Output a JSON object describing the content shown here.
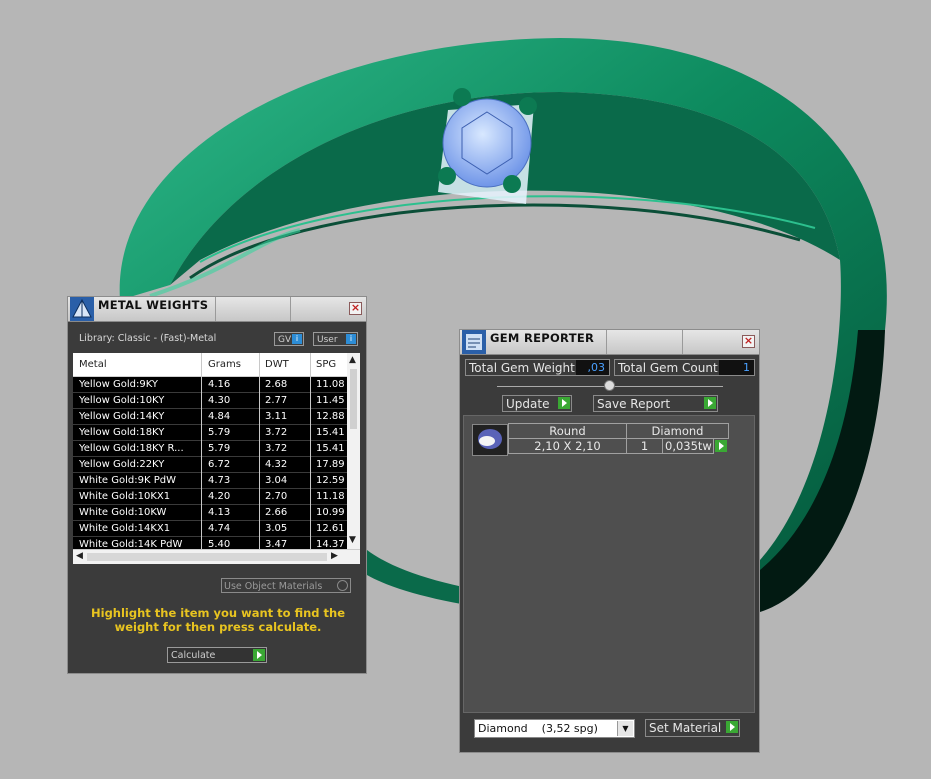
{
  "colors": {
    "background": "#b6b6b6",
    "ring": "#0f8a5f",
    "panel": "#3b3b3b",
    "hint": "#e8c420",
    "gem_value": "#4aa0ff",
    "play": "#3aa834"
  },
  "metal_weights": {
    "title": "METAL WEIGHTS",
    "library_label": "Library: Classic - (Fast)-Metal",
    "btn_gv": "GV",
    "btn_user": "User",
    "table": {
      "headers": [
        "Metal",
        "Grams",
        "DWT",
        "SPG"
      ],
      "rows": [
        [
          "Yellow Gold:9KY",
          "4.16",
          "2.68",
          "11.08"
        ],
        [
          "Yellow Gold:10KY",
          "4.30",
          "2.77",
          "11.45"
        ],
        [
          "Yellow Gold:14KY",
          "4.84",
          "3.11",
          "12.88"
        ],
        [
          "Yellow Gold:18KY",
          "5.79",
          "3.72",
          "15.41"
        ],
        [
          "Yellow Gold:18KY R...",
          "5.79",
          "3.72",
          "15.41"
        ],
        [
          "Yellow Gold:22KY",
          "6.72",
          "4.32",
          "17.89"
        ],
        [
          "White Gold:9K PdW",
          "4.73",
          "3.04",
          "12.59"
        ],
        [
          "White Gold:10KX1",
          "4.20",
          "2.70",
          "11.18"
        ],
        [
          "White Gold:10KW",
          "4.13",
          "2.66",
          "10.99"
        ],
        [
          "White Gold:14KX1",
          "4.74",
          "3.05",
          "12.61"
        ],
        [
          "White Gold:14K PdW",
          "5.40",
          "3.47",
          "14.37"
        ]
      ]
    },
    "use_object_materials": "Use Object Materials",
    "hint": "Highlight the item you want to find the weight for then press calculate.",
    "calculate": "Calculate"
  },
  "gem_reporter": {
    "title": "GEM REPORTER",
    "total_gem_weight_label": "Total Gem Weight",
    "total_gem_weight": ",03",
    "total_gem_count_label": "Total Gem Count",
    "total_gem_count": "1",
    "update": "Update",
    "save_report": "Save Report",
    "gem": {
      "shape": "Round",
      "size": "2,10 X 2,10",
      "material": "Diamond",
      "count": "1",
      "weight": "0,035tw"
    },
    "material_select": "Diamond    (3,52 spg)",
    "set_material": "Set Material"
  }
}
